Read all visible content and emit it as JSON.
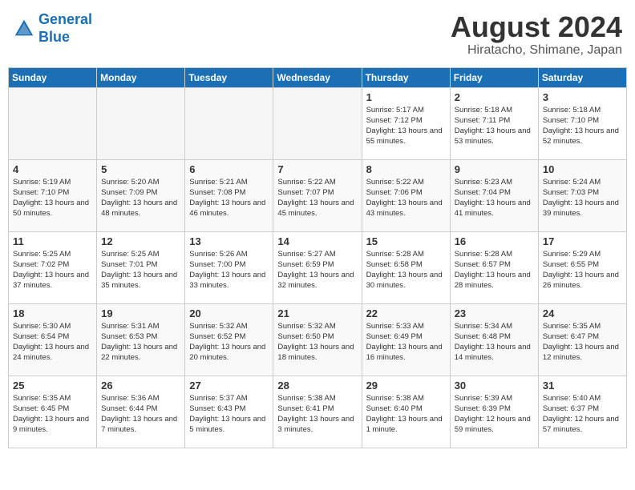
{
  "header": {
    "logo_line1": "General",
    "logo_line2": "Blue",
    "month_year": "August 2024",
    "location": "Hiratacho, Shimane, Japan"
  },
  "days_of_week": [
    "Sunday",
    "Monday",
    "Tuesday",
    "Wednesday",
    "Thursday",
    "Friday",
    "Saturday"
  ],
  "weeks": [
    [
      {
        "day": "",
        "empty": true
      },
      {
        "day": "",
        "empty": true
      },
      {
        "day": "",
        "empty": true
      },
      {
        "day": "",
        "empty": true
      },
      {
        "day": "1",
        "sunrise": "5:17 AM",
        "sunset": "7:12 PM",
        "daylight": "13 hours and 55 minutes."
      },
      {
        "day": "2",
        "sunrise": "5:18 AM",
        "sunset": "7:11 PM",
        "daylight": "13 hours and 53 minutes."
      },
      {
        "day": "3",
        "sunrise": "5:18 AM",
        "sunset": "7:10 PM",
        "daylight": "13 hours and 52 minutes."
      }
    ],
    [
      {
        "day": "4",
        "sunrise": "5:19 AM",
        "sunset": "7:10 PM",
        "daylight": "13 hours and 50 minutes."
      },
      {
        "day": "5",
        "sunrise": "5:20 AM",
        "sunset": "7:09 PM",
        "daylight": "13 hours and 48 minutes."
      },
      {
        "day": "6",
        "sunrise": "5:21 AM",
        "sunset": "7:08 PM",
        "daylight": "13 hours and 46 minutes."
      },
      {
        "day": "7",
        "sunrise": "5:22 AM",
        "sunset": "7:07 PM",
        "daylight": "13 hours and 45 minutes."
      },
      {
        "day": "8",
        "sunrise": "5:22 AM",
        "sunset": "7:06 PM",
        "daylight": "13 hours and 43 minutes."
      },
      {
        "day": "9",
        "sunrise": "5:23 AM",
        "sunset": "7:04 PM",
        "daylight": "13 hours and 41 minutes."
      },
      {
        "day": "10",
        "sunrise": "5:24 AM",
        "sunset": "7:03 PM",
        "daylight": "13 hours and 39 minutes."
      }
    ],
    [
      {
        "day": "11",
        "sunrise": "5:25 AM",
        "sunset": "7:02 PM",
        "daylight": "13 hours and 37 minutes."
      },
      {
        "day": "12",
        "sunrise": "5:25 AM",
        "sunset": "7:01 PM",
        "daylight": "13 hours and 35 minutes."
      },
      {
        "day": "13",
        "sunrise": "5:26 AM",
        "sunset": "7:00 PM",
        "daylight": "13 hours and 33 minutes."
      },
      {
        "day": "14",
        "sunrise": "5:27 AM",
        "sunset": "6:59 PM",
        "daylight": "13 hours and 32 minutes."
      },
      {
        "day": "15",
        "sunrise": "5:28 AM",
        "sunset": "6:58 PM",
        "daylight": "13 hours and 30 minutes."
      },
      {
        "day": "16",
        "sunrise": "5:28 AM",
        "sunset": "6:57 PM",
        "daylight": "13 hours and 28 minutes."
      },
      {
        "day": "17",
        "sunrise": "5:29 AM",
        "sunset": "6:55 PM",
        "daylight": "13 hours and 26 minutes."
      }
    ],
    [
      {
        "day": "18",
        "sunrise": "5:30 AM",
        "sunset": "6:54 PM",
        "daylight": "13 hours and 24 minutes."
      },
      {
        "day": "19",
        "sunrise": "5:31 AM",
        "sunset": "6:53 PM",
        "daylight": "13 hours and 22 minutes."
      },
      {
        "day": "20",
        "sunrise": "5:32 AM",
        "sunset": "6:52 PM",
        "daylight": "13 hours and 20 minutes."
      },
      {
        "day": "21",
        "sunrise": "5:32 AM",
        "sunset": "6:50 PM",
        "daylight": "13 hours and 18 minutes."
      },
      {
        "day": "22",
        "sunrise": "5:33 AM",
        "sunset": "6:49 PM",
        "daylight": "13 hours and 16 minutes."
      },
      {
        "day": "23",
        "sunrise": "5:34 AM",
        "sunset": "6:48 PM",
        "daylight": "13 hours and 14 minutes."
      },
      {
        "day": "24",
        "sunrise": "5:35 AM",
        "sunset": "6:47 PM",
        "daylight": "13 hours and 12 minutes."
      }
    ],
    [
      {
        "day": "25",
        "sunrise": "5:35 AM",
        "sunset": "6:45 PM",
        "daylight": "13 hours and 9 minutes."
      },
      {
        "day": "26",
        "sunrise": "5:36 AM",
        "sunset": "6:44 PM",
        "daylight": "13 hours and 7 minutes."
      },
      {
        "day": "27",
        "sunrise": "5:37 AM",
        "sunset": "6:43 PM",
        "daylight": "13 hours and 5 minutes."
      },
      {
        "day": "28",
        "sunrise": "5:38 AM",
        "sunset": "6:41 PM",
        "daylight": "13 hours and 3 minutes."
      },
      {
        "day": "29",
        "sunrise": "5:38 AM",
        "sunset": "6:40 PM",
        "daylight": "13 hours and 1 minute."
      },
      {
        "day": "30",
        "sunrise": "5:39 AM",
        "sunset": "6:39 PM",
        "daylight": "12 hours and 59 minutes."
      },
      {
        "day": "31",
        "sunrise": "5:40 AM",
        "sunset": "6:37 PM",
        "daylight": "12 hours and 57 minutes."
      }
    ]
  ]
}
